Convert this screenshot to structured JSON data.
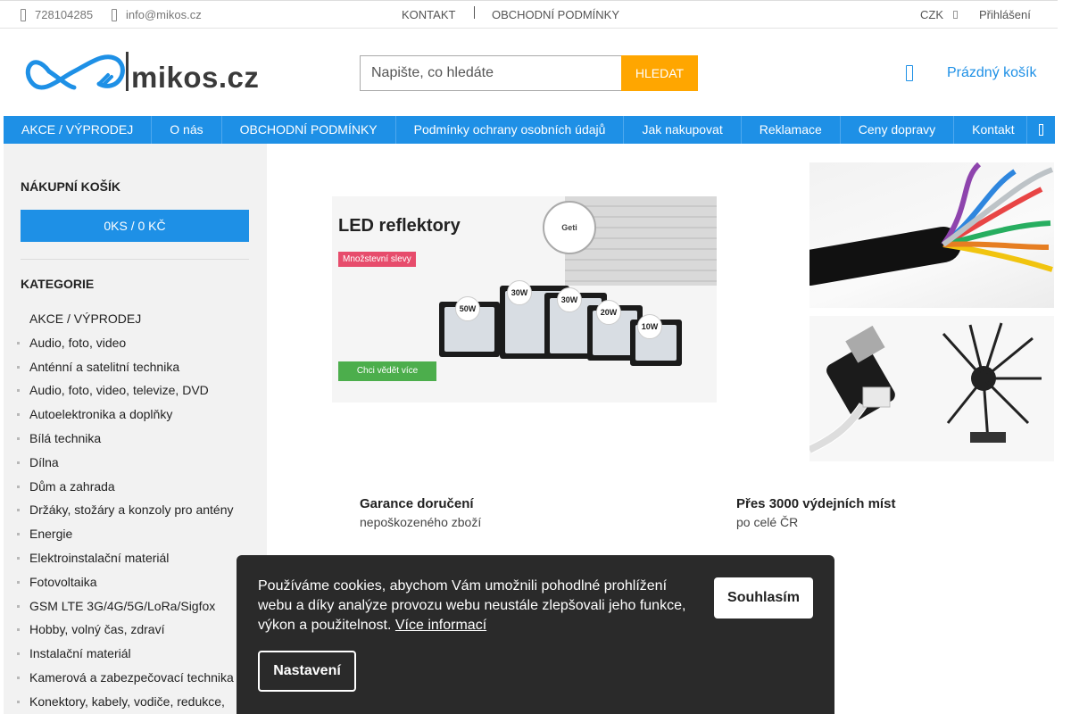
{
  "topbar": {
    "phone": "728104285",
    "email": "info@mikos.cz",
    "links": [
      "KONTAKT",
      "OBCHODNÍ PODMÍNKY"
    ],
    "currency": "CZK",
    "login": "Přihlášení"
  },
  "header": {
    "logo_text": "mikos.cz",
    "search_placeholder": "Napište, co hledáte",
    "search_button": "HLEDAT",
    "cart_label": "Prázdný košík"
  },
  "nav": {
    "items": [
      "AKCE / VÝPRODEJ",
      "O nás",
      "OBCHODNÍ PODMÍNKY",
      "Podmínky ochrany osobních údajů",
      "Jak nakupovat",
      "Reklamace",
      "Ceny dopravy",
      "Kontakt"
    ]
  },
  "sidebar": {
    "cart_heading": "NÁKUPNÍ KOŠÍK",
    "cart_summary": "0KS / 0 KČ",
    "categories_heading": "KATEGORIE",
    "categories": [
      "AKCE / VÝPRODEJ",
      "Audio, foto, video",
      "Anténní a satelitní technika",
      "Audio, foto, video, televize, DVD",
      "Autoelektronika a doplňky",
      "Bílá technika",
      "Dílna",
      "Dům a zahrada",
      "Držáky, stožáry a konzoly pro antény",
      "Energie",
      "Elektroinstalační materiál",
      "Fotovoltaika",
      "GSM LTE 3G/4G/5G/LoRa/Sigfox",
      "Hobby, volný čas, zdraví",
      "Instalační materiál",
      "Kamerová a zabezpečovací technika",
      "Konektory, kabely, vodiče, redukce,"
    ]
  },
  "banner": {
    "title": "LED reflektory",
    "badge": "Množstevní slevy",
    "cta": "Chci vědět více",
    "brand_badge": "Geti",
    "watts": [
      "50W",
      "30W",
      "30W",
      "20W",
      "10W"
    ]
  },
  "features": [
    {
      "title": "Garance doručení",
      "subtitle": "nepoškozeného zboží"
    },
    {
      "title": "Přes 3000 výdejních míst",
      "subtitle": "po celé ČR"
    }
  ],
  "cookie": {
    "text": "Používáme cookies, abychom Vám umožnili pohodlné prohlížení webu a díky analýze provozu webu neustále zlepšovali jeho funkce, výkon a použitelnost.",
    "more_link": "Více informací",
    "accept": "Souhlasím",
    "settings": "Nastavení"
  },
  "colors": {
    "primary": "#1e90e6",
    "search_button": "#ffa600",
    "cookie_bg": "#2a2a2a"
  }
}
